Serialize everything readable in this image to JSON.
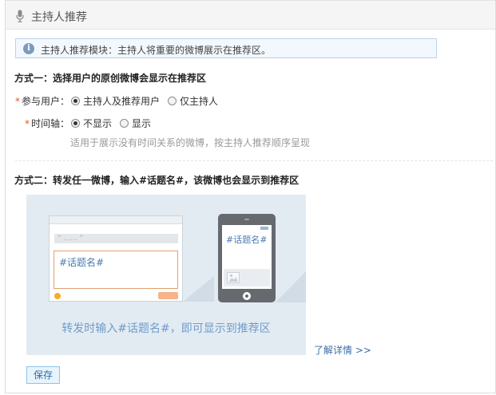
{
  "header": {
    "title": "主持人推荐",
    "icon": "microphone-icon"
  },
  "tip": {
    "icon": "info-icon",
    "text": "主持人推荐模块：主持人将重要的微博展示在推荐区。"
  },
  "method1": {
    "title": "方式一：选择用户的原创微博会显示在推荐区",
    "participants": {
      "required_mark": "*",
      "label": "参与用户：",
      "options": [
        "主持人及推荐用户",
        "仅主持人"
      ],
      "selected": "主持人及推荐用户"
    },
    "timeline": {
      "required_mark": "*",
      "label": "时间轴：",
      "options": [
        "不显示",
        "显示"
      ],
      "selected": "不显示"
    },
    "hint": "适用于展示没有时间关系的微博，按主持人推荐顺序呈现"
  },
  "method2": {
    "title": "方式二：转发任一微博，输入#话题名#，该微博也会显示到推荐区",
    "illustration": {
      "search_placeholder": "“ ...... ”",
      "box_text": "#话题名#",
      "phone_text": "#话题名#",
      "caption": "转发时输入#话题名#，即可显示到推荐区"
    },
    "more_link": "了解详情 >>"
  },
  "actions": {
    "save_label": "保存"
  },
  "colors": {
    "accent": "#3a6ea5",
    "required": "#e05a1a",
    "tip_border": "#b9d3ea",
    "illustration_bg": "#e3ebf2"
  }
}
